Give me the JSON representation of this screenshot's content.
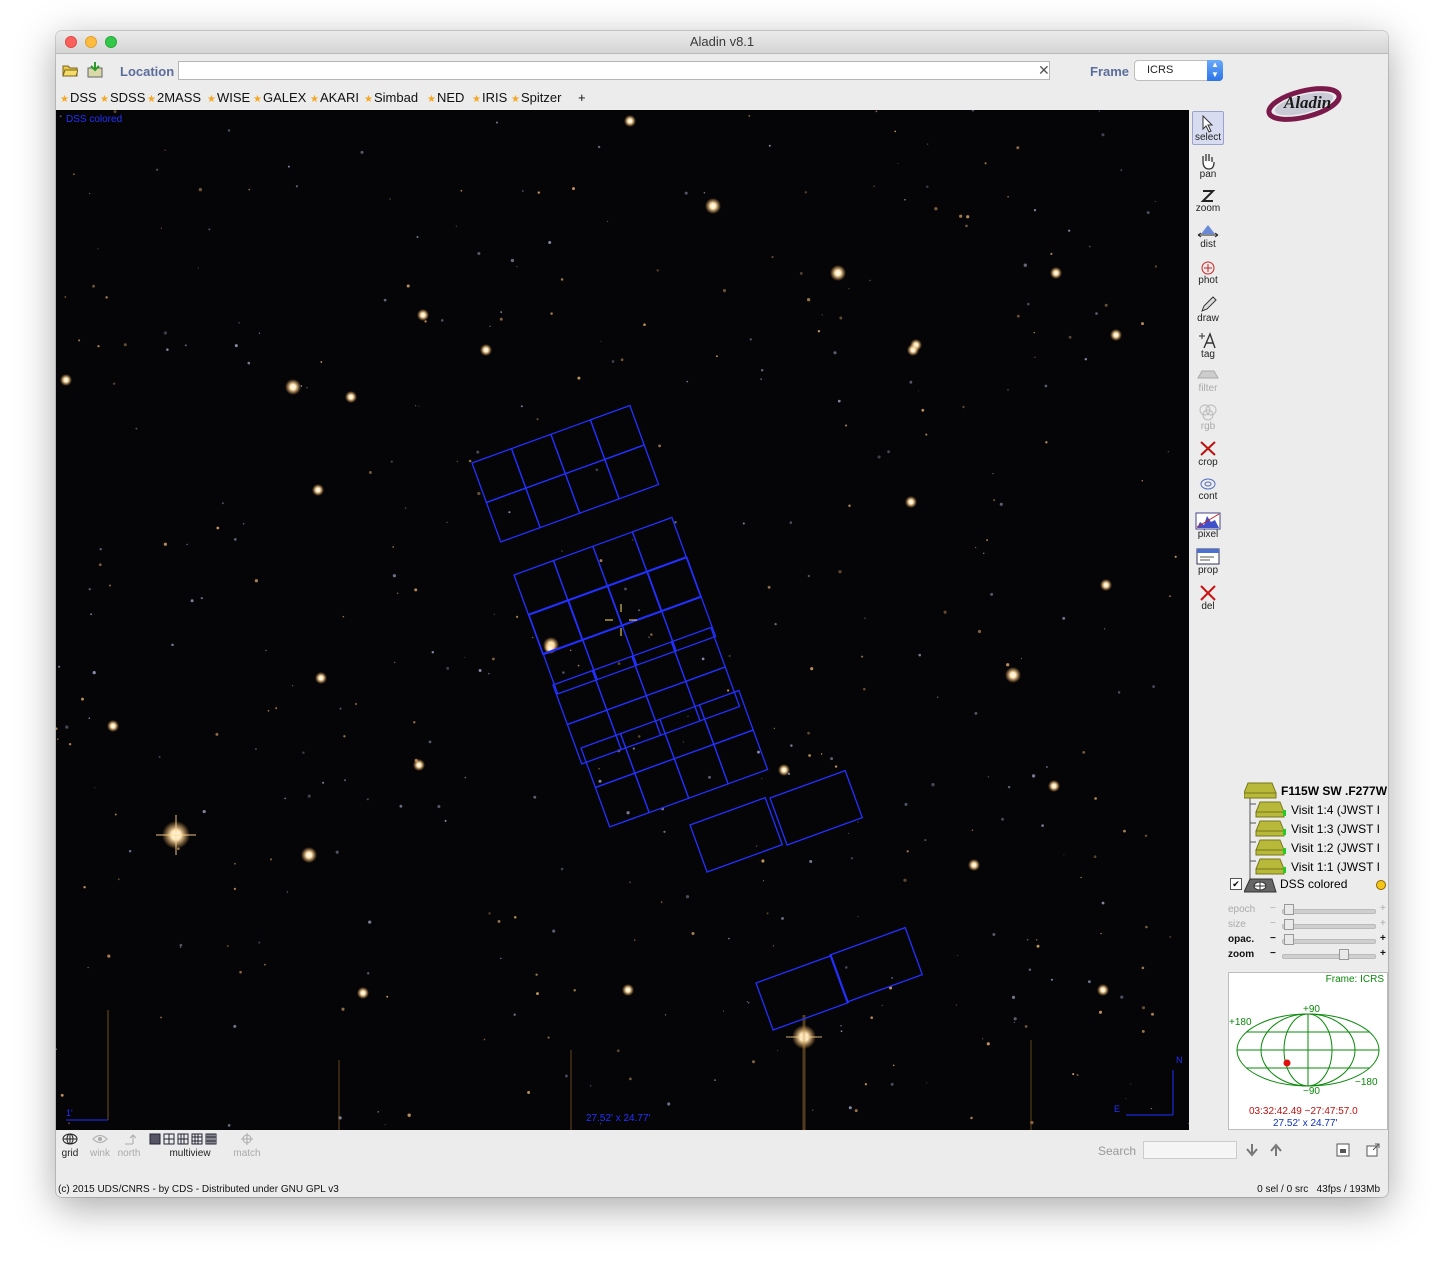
{
  "window": {
    "title": "Aladin v8.1"
  },
  "toolbar": {
    "location_label": "Location",
    "location_value": "",
    "frame_label": "Frame",
    "frame_value": "ICRS"
  },
  "surveys": [
    "DSS",
    "SDSS",
    "2MASS",
    "WISE",
    "GALEX",
    "AKARI",
    "Simbad",
    "NED",
    "IRIS",
    "Spitzer"
  ],
  "add_survey_label": "+",
  "view": {
    "image_label": "DSS colored",
    "field_size": "27.52' x 24.77'",
    "scale_label": "1'",
    "compass_n": "N",
    "compass_e": "E"
  },
  "tools": [
    {
      "name": "select",
      "label": "select",
      "icon": "arrow-pointer-icon",
      "state": "active"
    },
    {
      "name": "pan",
      "label": "pan",
      "icon": "hand-icon",
      "state": "normal"
    },
    {
      "name": "zoom",
      "label": "zoom",
      "icon": "zoom-z-icon",
      "state": "normal"
    },
    {
      "name": "dist",
      "label": "dist",
      "icon": "distance-icon",
      "state": "normal"
    },
    {
      "name": "phot",
      "label": "phot",
      "icon": "photometry-icon",
      "state": "normal"
    },
    {
      "name": "draw",
      "label": "draw",
      "icon": "pencil-icon",
      "state": "normal"
    },
    {
      "name": "tag",
      "label": "tag",
      "icon": "tag-text-icon",
      "state": "normal"
    },
    {
      "name": "filter",
      "label": "filter",
      "icon": "filter-icon",
      "state": "disabled"
    },
    {
      "name": "rgb",
      "label": "rgb",
      "icon": "rgb-icon",
      "state": "disabled"
    },
    {
      "name": "crop",
      "label": "crop",
      "icon": "scissors-icon",
      "state": "normal"
    },
    {
      "name": "cont",
      "label": "cont",
      "icon": "contour-icon",
      "state": "normal"
    },
    {
      "name": "pixel",
      "label": "pixel",
      "icon": "histogram-icon",
      "state": "normal"
    },
    {
      "name": "prop",
      "label": "prop",
      "icon": "properties-icon",
      "state": "normal"
    },
    {
      "name": "del",
      "label": "del",
      "icon": "delete-x-icon",
      "state": "normal"
    }
  ],
  "layers": [
    {
      "label": "F115W SW .F277W",
      "type": "folder"
    },
    {
      "label": "Visit 1:4 (JWST I",
      "type": "footprint"
    },
    {
      "label": "Visit 1:3 (JWST I",
      "type": "footprint"
    },
    {
      "label": "Visit 1:2 (JWST I",
      "type": "footprint"
    },
    {
      "label": "Visit 1:1 (JWST I",
      "type": "footprint"
    },
    {
      "label": "DSS colored",
      "type": "image"
    }
  ],
  "sliders": [
    {
      "label": "epoch",
      "value": 0.0,
      "enabled": false
    },
    {
      "label": "size",
      "value": 0.0,
      "enabled": false
    },
    {
      "label": "opac.",
      "value": 0.0,
      "enabled": true
    },
    {
      "label": "zoom",
      "value": 0.65,
      "enabled": true
    }
  ],
  "minimap": {
    "frame_text": "Frame: ICRS",
    "lat_top": "+90",
    "lat_bottom": "−90",
    "lon_left": "+180",
    "lon_right": "−180",
    "coords": "03:32:42.49 −27:47:57.0",
    "size": "27.52' x 24.77'"
  },
  "bottom": {
    "grid": "grid",
    "wink": "wink",
    "north": "north",
    "multiview": "multiview",
    "match": "match",
    "search_label": "Search"
  },
  "status": {
    "left": "(c) 2015 UDS/CNRS - by CDS - Distributed under GNU GPL v3",
    "sel": "0 sel / 0 src",
    "perf": "43fps / 193Mb"
  }
}
